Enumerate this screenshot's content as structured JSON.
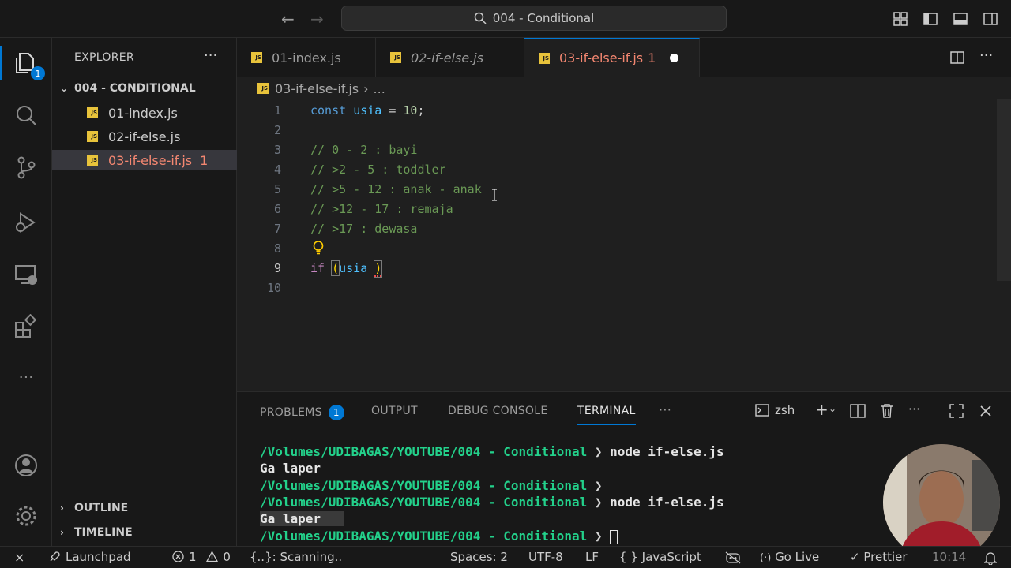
{
  "titlebar": {
    "search_text": "004 - Conditional",
    "back": "←",
    "forward": "→"
  },
  "activitybar": {
    "explorer_badge": "1"
  },
  "explorer": {
    "title": "EXPLORER",
    "more": "···",
    "folder": "004 - CONDITIONAL",
    "files": [
      {
        "name": "01-index.js",
        "problems": ""
      },
      {
        "name": "02-if-else.js",
        "problems": ""
      },
      {
        "name": "03-if-else-if.js",
        "problems": "1"
      }
    ],
    "outline": "OUTLINE",
    "timeline": "TIMELINE"
  },
  "tabs": [
    {
      "label": "01-index.js"
    },
    {
      "label": "02-if-else.js"
    },
    {
      "label": "03-if-else-if.js",
      "problems": "1"
    }
  ],
  "breadcrumb": {
    "file": "03-if-else-if.js",
    "sep": "›",
    "rest": "..."
  },
  "editor": {
    "line_numbers": [
      "1",
      "2",
      "3",
      "4",
      "5",
      "6",
      "7",
      "8",
      "9",
      "10"
    ],
    "line1": {
      "kw": "const",
      "var": "usia",
      "op": " = ",
      "num": "10",
      "end": ";"
    },
    "comments": [
      "// 0 - 2 : bayi",
      "// >2 - 5 : toddler",
      "// >5 - 12 : anak - anak",
      "// >12 - 17 : remaja",
      "// >17 : dewasa"
    ],
    "line9": {
      "kw": "if",
      "open": "(",
      "var": "usia",
      "close": ")"
    }
  },
  "panel": {
    "tabs": {
      "problems": "PROBLEMS",
      "problems_count": "1",
      "output": "OUTPUT",
      "debug_console": "DEBUG CONSOLE",
      "terminal": "TERMINAL",
      "more": "···"
    },
    "shell": "zsh",
    "terminal": {
      "prompt_path": "/Volumes/UDIBAGAS/YOUTUBE/004 - Conditional",
      "prompt_arrow": "❯",
      "cmd1": "node if-else.js",
      "out1": "Ga laper",
      "cmd2": "node if-else.js",
      "out2": "Ga laper"
    }
  },
  "statusbar": {
    "remote": "⨯",
    "launchpad": "Launchpad",
    "errors": "1",
    "warnings": "0",
    "scanning": "{..}: Scanning..",
    "spaces": "Spaces: 2",
    "encoding": "UTF-8",
    "eol": "LF",
    "braces": "{ }",
    "language": "JavaScript",
    "golive": "Go Live",
    "prettier": "Prettier",
    "time": "10:14"
  },
  "colors": {
    "accent": "#0078d4",
    "error": "#f48771",
    "terminal_path": "#23d18b",
    "js_icon": "#e8c33b"
  }
}
